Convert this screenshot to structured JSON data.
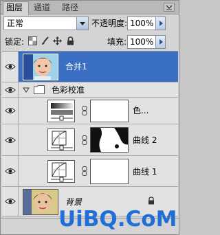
{
  "tabs": [
    {
      "label": "图层",
      "active": true
    },
    {
      "label": "通道",
      "active": false
    },
    {
      "label": "路径",
      "active": false
    }
  ],
  "blend_mode": "正常",
  "opacity": {
    "label": "不透明度:",
    "value": "100%"
  },
  "lock": {
    "label": "锁定:"
  },
  "fill": {
    "label": "填充:",
    "value": "100%"
  },
  "layers": [
    {
      "name": "合并1",
      "selected": true,
      "type": "photo"
    },
    {
      "name": "色彩校准",
      "type": "group"
    },
    {
      "name": "色...",
      "type": "adjustment-gradient"
    },
    {
      "name": "曲线 2",
      "type": "adjustment-curves"
    },
    {
      "name": "曲线 1",
      "type": "adjustment-curves"
    },
    {
      "name": "背景",
      "type": "background",
      "locked": true
    }
  ],
  "watermark": "UiBQ.CoM",
  "colors": {
    "selection": "#3a6fc4",
    "watermark": "#1f6fd6"
  }
}
